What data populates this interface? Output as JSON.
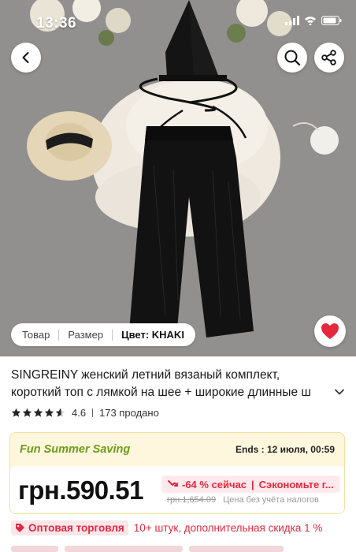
{
  "status_bar": {
    "time": "13:36"
  },
  "colors": {
    "accent_red": "#e5283f",
    "promo_green": "#6b9c17",
    "promo_bg": "#fff7dd"
  },
  "icons": {
    "back": "chevron-left-icon",
    "search": "search-icon",
    "share": "share-icon",
    "favorite": "heart-icon",
    "expand": "chevron-down-icon",
    "star": "star-icon",
    "price_down": "arrow-down-icon",
    "wholesale": "tag-icon"
  },
  "sku_bar": {
    "product_tab": "Товар",
    "size_tab": "Размер",
    "color_tab": "Цвет: KHAKI"
  },
  "product": {
    "title_line1": "SINGREINY женский летний вязаный комплект,",
    "title_line2": "короткий топ с лямкой на шее + широкие длинные ш",
    "rating": 4.6,
    "rating_text": "4.6",
    "sold_text": "173 продано"
  },
  "promo": {
    "name": "Fun Summer Saving",
    "ends": "Ends : 12 июля, 00:59",
    "price": "грн.590.51",
    "discount": "-64 % сейчас",
    "save_text": "Сэкономьте г...",
    "old_price": "грн.1,654.09",
    "tax_note": "Цена без учёта налогов"
  },
  "wholesale": {
    "badge": "Оптовая торговля",
    "text": "10+ штук, дополнительная скидка 1 %"
  }
}
